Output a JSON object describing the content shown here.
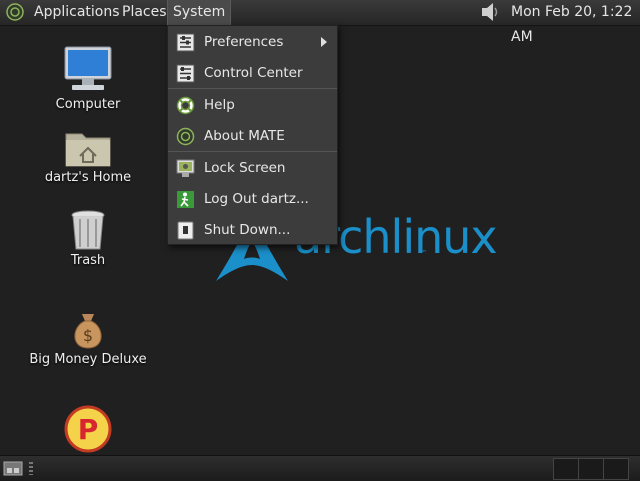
{
  "top_panel": {
    "menus": [
      "Applications",
      "Places",
      "System"
    ],
    "clock": "Mon Feb 20,  1:22 AM",
    "volume_icon": "speaker-icon"
  },
  "wallpaper": {
    "brand_text": "archlinux",
    "brand_color": "#1b8fc9"
  },
  "desktop": {
    "icons": [
      {
        "label": "Computer",
        "icon": "computer-icon"
      },
      {
        "label": "dartz's Home",
        "icon": "home-folder-icon"
      },
      {
        "label": "Trash",
        "icon": "trash-icon"
      },
      {
        "label": "Big Money Deluxe",
        "icon": "money-bag-icon"
      },
      {
        "label": "",
        "icon": "game-p-icon"
      }
    ]
  },
  "system_menu": {
    "items": [
      {
        "label": "Preferences",
        "icon": "preferences-icon",
        "submenu": true
      },
      {
        "label": "Control Center",
        "icon": "control-center-icon"
      },
      {
        "label": "Help",
        "icon": "help-icon"
      },
      {
        "label": "About MATE",
        "icon": "mate-icon"
      },
      {
        "label": "Lock Screen",
        "icon": "lock-screen-icon"
      },
      {
        "label": "Log Out dartz...",
        "icon": "logout-icon"
      },
      {
        "label": "Shut Down...",
        "icon": "shutdown-icon"
      }
    ]
  }
}
